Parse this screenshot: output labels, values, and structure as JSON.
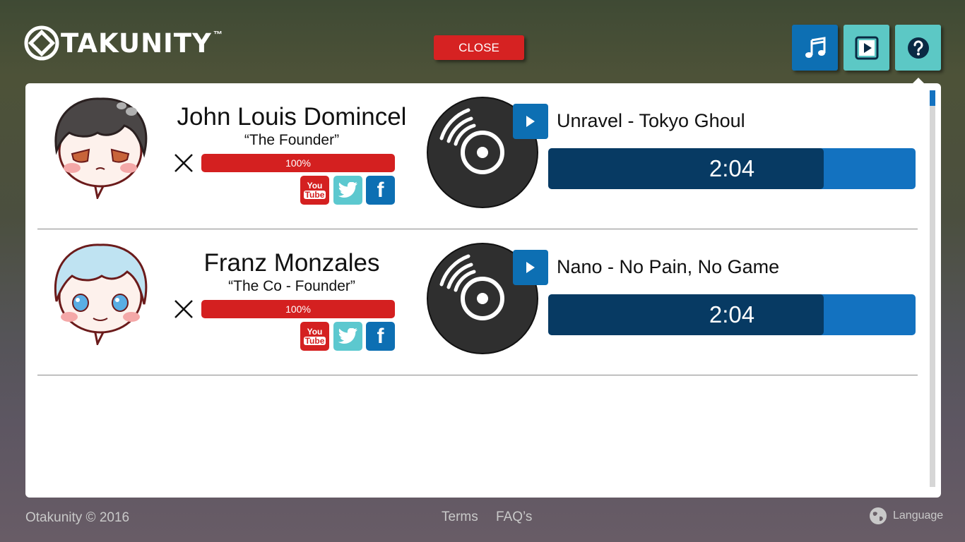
{
  "brand": {
    "name": "TAKUNITY",
    "trademark": "™"
  },
  "header": {
    "close_label": "CLOSE",
    "icons": [
      "music-note-icon",
      "video-play-icon",
      "help-question-icon"
    ]
  },
  "people": [
    {
      "name": "John Louis Domincel",
      "title": "“The Founder”",
      "level_text": "100%",
      "level": 1.0,
      "social": [
        "youtube-icon",
        "twitter-icon",
        "facebook-icon"
      ],
      "song": "Unravel - Tokyo Ghoul",
      "time": "2:04",
      "progress": 0.75
    },
    {
      "name": "Franz Monzales",
      "title": "“The Co - Founder”",
      "level_text": "100%",
      "level": 1.0,
      "social": [
        "youtube-icon",
        "twitter-icon",
        "facebook-icon"
      ],
      "song": "Nano - No Pain, No Game",
      "time": "2:04",
      "progress": 0.75
    }
  ],
  "social_labels": {
    "youtube_top": "You",
    "youtube_bottom": "Tube",
    "facebook": "f"
  },
  "footer": {
    "copyright": "Otakunity © 2016",
    "links": [
      "Terms",
      "FAQ’s"
    ],
    "language": "Language"
  },
  "colors": {
    "accent_red": "#d42020",
    "accent_blue": "#0d6fb3",
    "accent_teal": "#5cc8c5",
    "track_dark": "#073a63"
  }
}
